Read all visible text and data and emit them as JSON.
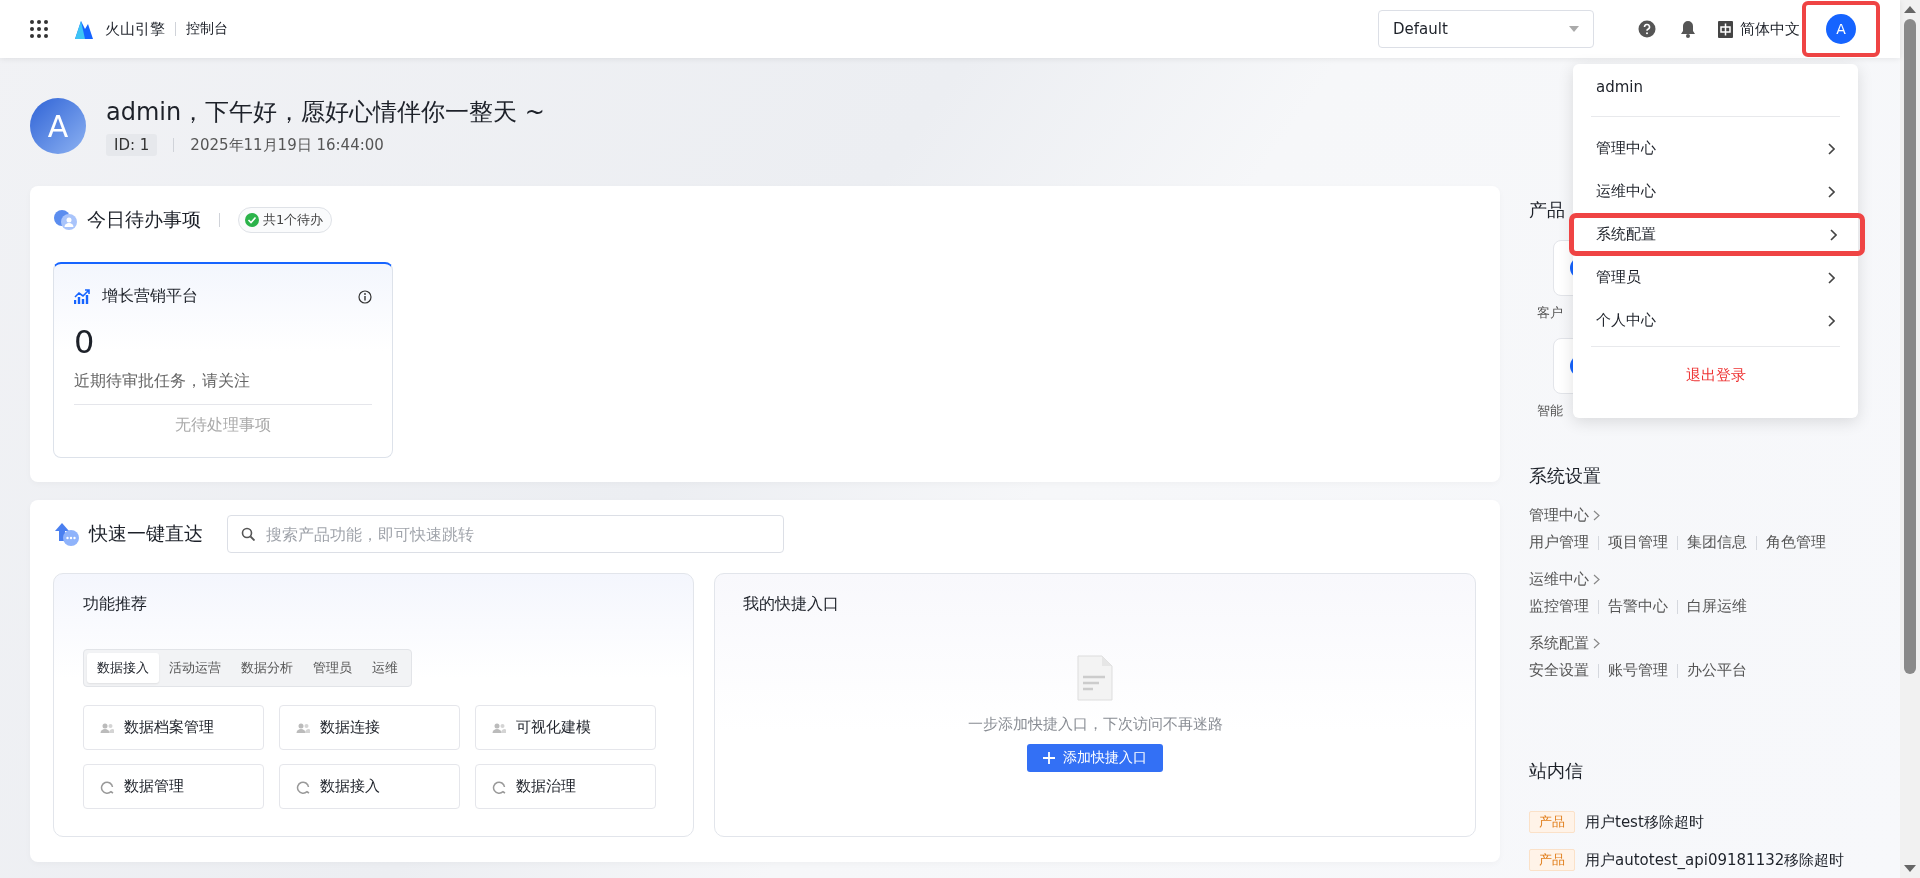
{
  "topbar": {
    "brand": "火山引擎",
    "console": "控制台",
    "workspace_select": {
      "value": "Default"
    },
    "language": "简体中文",
    "avatar": "A",
    "avatar_highlighted": true
  },
  "greeting": {
    "avatar": "A",
    "title": "admin，下午好，愿好心情伴你一整天 ~",
    "id_badge": "ID: 1",
    "datetime": "2025年11月19日 16:44:00"
  },
  "todo": {
    "title": "今日待办事项",
    "badge": "共1个待办",
    "cards": [
      {
        "title": "增长营销平台",
        "count": "0",
        "description": "近期待审批任务，请关注",
        "footer": "无待处理事项"
      }
    ]
  },
  "quick_access": {
    "title": "快速一键直达",
    "search": {
      "placeholder": "搜索产品功能，即可快速跳转"
    },
    "recommend": {
      "title": "功能推荐",
      "tabs": [
        {
          "label": "数据接入",
          "selected": true
        },
        {
          "label": "活动运营",
          "selected": false
        },
        {
          "label": "数据分析",
          "selected": false
        },
        {
          "label": "管理员",
          "selected": false
        },
        {
          "label": "运维",
          "selected": false
        }
      ],
      "items": [
        {
          "label": "数据档案管理",
          "kind": "people"
        },
        {
          "label": "数据连接",
          "kind": "people"
        },
        {
          "label": "可视化建模",
          "kind": "people"
        },
        {
          "label": "数据管理",
          "kind": "loading"
        },
        {
          "label": "数据接入",
          "kind": "loading"
        },
        {
          "label": "数据治理",
          "kind": "loading"
        }
      ]
    },
    "shortcuts": {
      "title": "我的快捷入口",
      "empty_text": "一步添加快捷入口，下次访问不再迷路",
      "add_button": "添加快捷入口"
    }
  },
  "side": {
    "products": {
      "title": "产品",
      "tiles": [
        {
          "label": "客户"
        },
        {
          "label": "智能"
        }
      ]
    },
    "settings": {
      "title": "系统设置",
      "groups": [
        {
          "title": "管理中心",
          "links": [
            "用户管理",
            "项目管理",
            "集团信息",
            "角色管理"
          ]
        },
        {
          "title": "运维中心",
          "links": [
            "监控管理",
            "告警中心",
            "白屏运维"
          ]
        },
        {
          "title": "系统配置",
          "links": [
            "安全设置",
            "账号管理",
            "办公平台"
          ]
        }
      ]
    },
    "inbox": {
      "title": "站内信",
      "messages": [
        {
          "tag": "产品",
          "text": "用户test移除超时"
        },
        {
          "tag": "产品",
          "text": "用户autotest_api09181132移除超时"
        }
      ]
    }
  },
  "user_menu": {
    "username": "admin",
    "items": [
      {
        "label": "管理中心",
        "highlighted": false
      },
      {
        "label": "运维中心",
        "highlighted": false
      },
      {
        "label": "系统配置",
        "highlighted": true
      },
      {
        "label": "管理员",
        "highlighted": false
      },
      {
        "label": "个人中心",
        "highlighted": false
      }
    ],
    "logout": "退出登录"
  }
}
